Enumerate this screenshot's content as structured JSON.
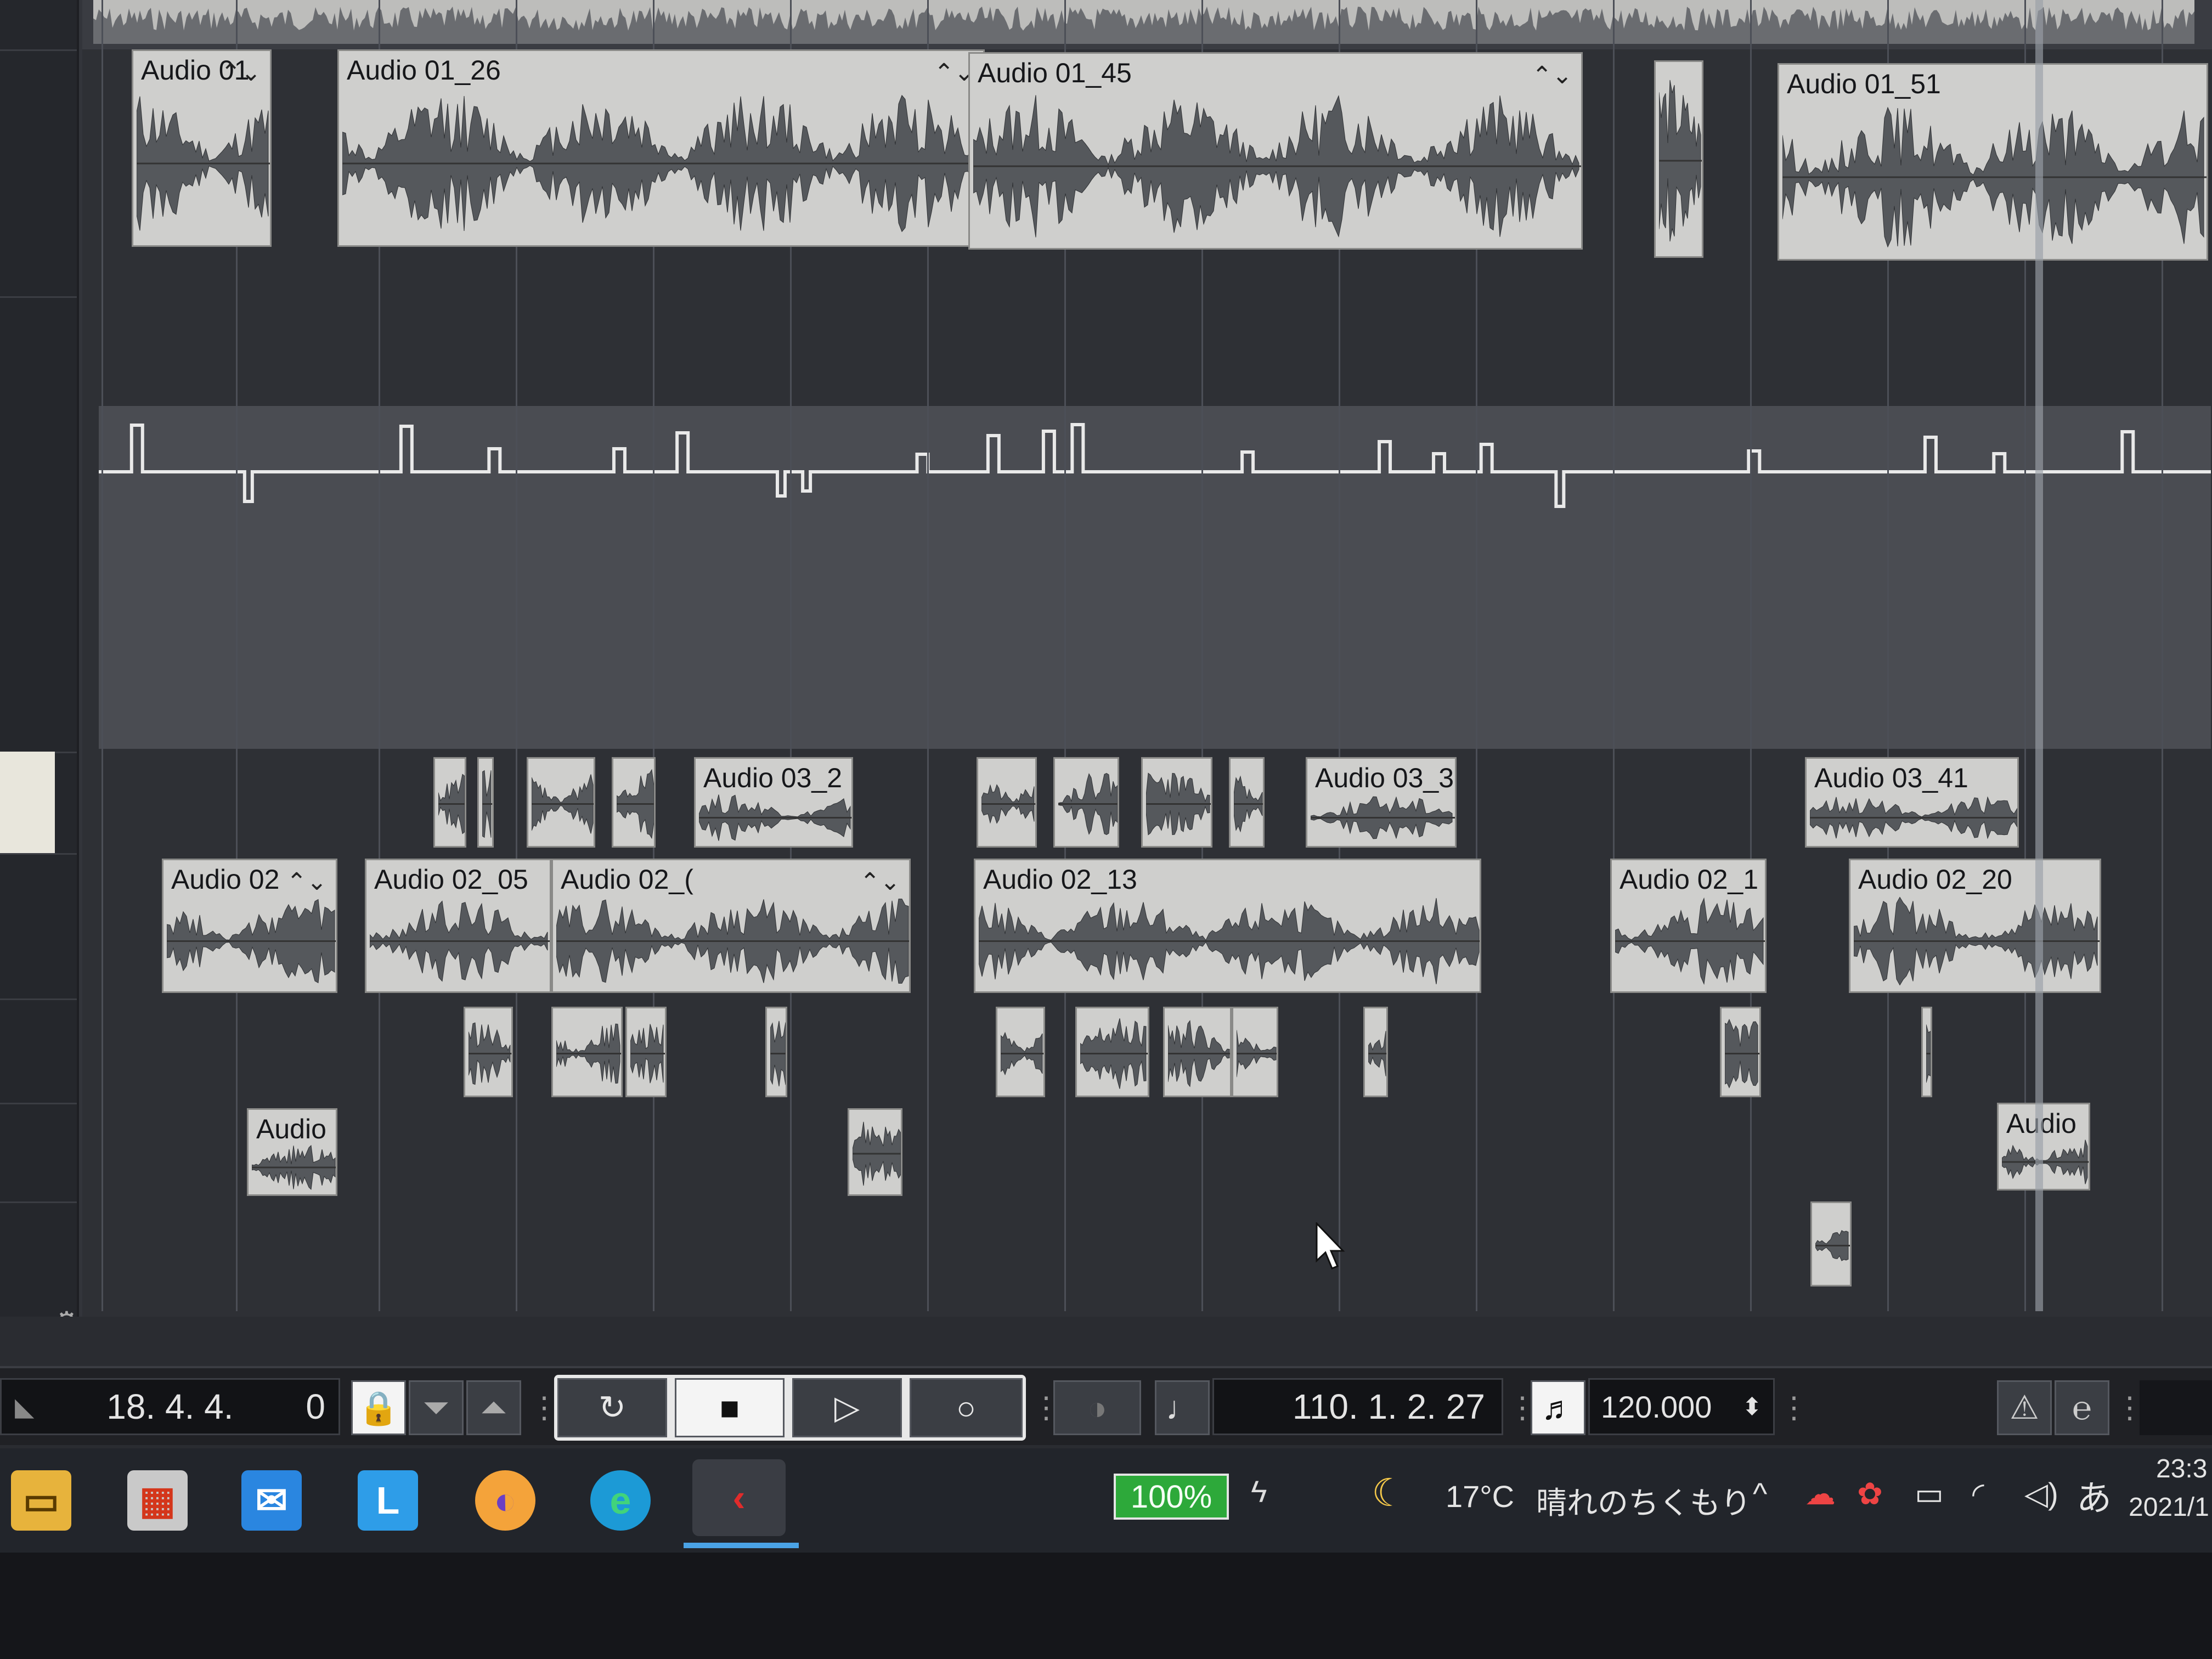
{
  "tracks": {
    "audio01": [
      {
        "name": "Audio 01",
        "fade": true
      },
      {
        "name": "Audio 01_26",
        "fade": true
      },
      {
        "name": "Audio 01_45",
        "fade": true
      },
      {
        "name": ""
      },
      {
        "name": "Audio 01_51",
        "fade": false
      }
    ],
    "audio03": [
      {
        "name": ""
      },
      {
        "name": ""
      },
      {
        "name": ""
      },
      {
        "name": ""
      },
      {
        "name": "Audio 03_2"
      },
      {
        "name": ""
      },
      {
        "name": ""
      },
      {
        "name": ""
      },
      {
        "name": ""
      },
      {
        "name": "Audio 03_3"
      },
      {
        "name": "Audio 03_41"
      }
    ],
    "audio02": [
      {
        "name": "Audio 02",
        "fade": true
      },
      {
        "name": "Audio 02_05",
        "fade": false
      },
      {
        "name": "Audio 02_(",
        "fade": true
      },
      {
        "name": "Audio 02_13",
        "fade": false
      },
      {
        "name": "Audio 02_1",
        "fade": false
      },
      {
        "name": "Audio 02_20",
        "fade": false
      }
    ],
    "audio_small_row": [
      {
        "name": ""
      },
      {
        "name": ""
      },
      {
        "name": ""
      },
      {
        "name": ""
      },
      {
        "name": ""
      },
      {
        "name": ""
      },
      {
        "name": ""
      },
      {
        "name": ""
      },
      {
        "name": ""
      },
      {
        "name": ""
      },
      {
        "name": ""
      }
    ],
    "audio_bottom_row": [
      {
        "name": "Audio"
      },
      {
        "name": ""
      },
      {
        "name": "Audio"
      },
      {
        "name": ""
      }
    ]
  },
  "fade_symbol": "⌃⌄",
  "transport": {
    "left_locator": "18. 4. 4.",
    "left_locator_ticks": "0",
    "position": "110. 1. 2. 27",
    "tempo": "120.000",
    "buttons": {
      "cycle": "↻",
      "stop": "■",
      "play": "▷",
      "record": "○"
    }
  },
  "taskbar": {
    "battery": "100%",
    "weather_temp": "17°C",
    "weather_text": "晴れのちくもり",
    "ime": "あ",
    "time": "23:3",
    "date": "2021/1"
  },
  "scroll": {
    "horizontal_position": 0.42
  },
  "colors": {
    "event_bg": "#cfcfcd",
    "waveform": "#55585c",
    "automation_line": "#e9e9e9",
    "battery": "#2da93a",
    "playhead": "#9aa0a8"
  }
}
